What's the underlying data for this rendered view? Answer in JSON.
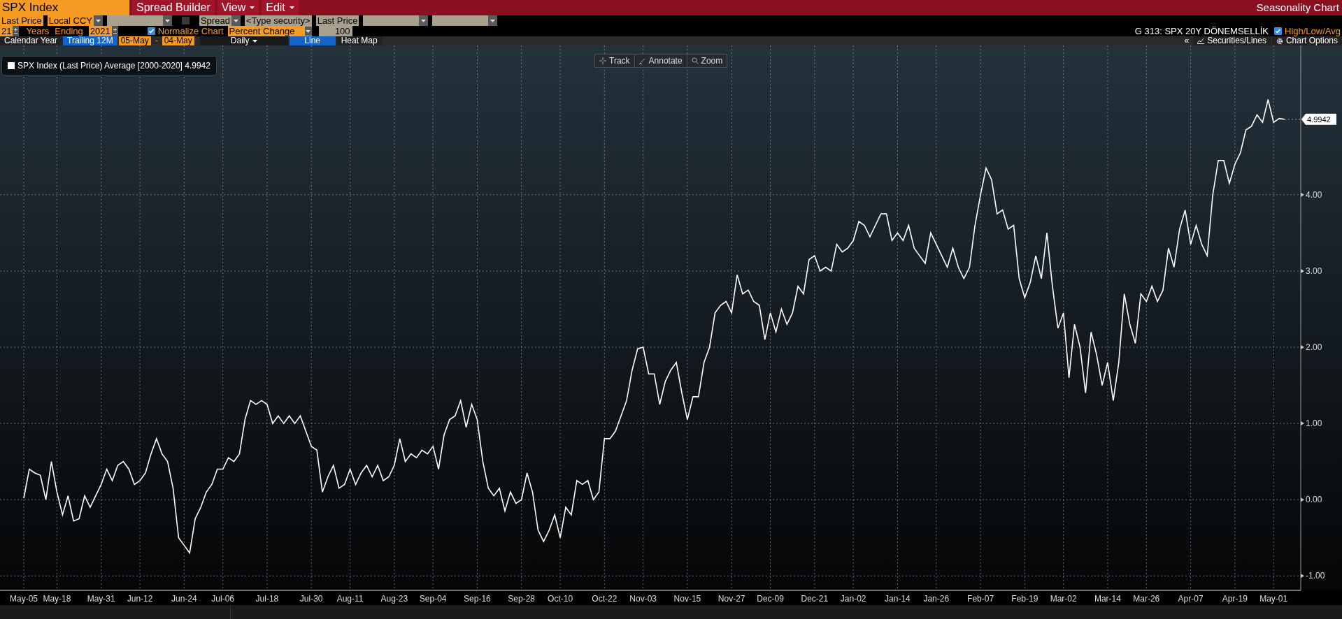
{
  "menu_bar": {
    "security": "SPX Index",
    "items": [
      {
        "label": "Spread Builder",
        "dropdown": false
      },
      {
        "label": "View",
        "dropdown": true
      },
      {
        "label": "Edit",
        "dropdown": true
      }
    ],
    "title": "Seasonality Chart"
  },
  "fields_row": [
    {
      "kind": "primary",
      "value": "Last Price",
      "dropdown": false
    },
    {
      "kind": "primary",
      "value": "Local CCY",
      "dropdown": true
    },
    {
      "kind": "secondary",
      "dropdown": true
    },
    {
      "kind": "checkbox",
      "checked": false
    },
    {
      "kind": "secondary",
      "value": "Spread",
      "dropdown": true
    },
    {
      "kind": "secondary",
      "value": "<Type security>",
      "dropdown": false
    },
    {
      "kind": "secondary",
      "value": "Last Price",
      "dropdown": false
    },
    {
      "kind": "secondary",
      "dropdown": true
    },
    {
      "kind": "secondary",
      "dropdown": true
    }
  ],
  "options_row": {
    "years": "21",
    "years_label": "Years",
    "ending_label": "Ending",
    "end_year": "2021",
    "normalize": {
      "label": "Normalize Chart",
      "checked": true
    },
    "mode": "Percent Change",
    "base": "100",
    "chart_name": "G 313: SPX 20Y DÖNEMSELLİK",
    "high_low_avg": {
      "label": "High/Low/Avg",
      "checked": true
    }
  },
  "range_row": {
    "period_tabs": [
      {
        "label": "Calendar Year",
        "selected": false
      },
      {
        "label": "Trailing 12M",
        "selected": true
      }
    ],
    "start": "05-May",
    "separator": "-",
    "end": "04-May",
    "frequency": "Daily",
    "view_tabs": [
      {
        "label": "Line",
        "selected": true
      },
      {
        "label": "Heat Map",
        "selected": false
      }
    ],
    "collapse": "«",
    "securities": "Securities/Lines",
    "chart_options": "Chart Options"
  },
  "chart": {
    "legend_value": "4.9942",
    "tools": [
      "Track",
      "Annotate",
      "Zoom"
    ],
    "chart_data": {
      "type": "line",
      "grid": true,
      "ylim": [
        -1.19,
        5.96
      ],
      "categories": [
        "May-05",
        null,
        null,
        null,
        null,
        null,
        "May-18",
        null,
        null,
        null,
        null,
        null,
        null,
        null,
        "May-31",
        null,
        null,
        null,
        null,
        null,
        null,
        "Jun-12",
        null,
        null,
        null,
        null,
        null,
        null,
        null,
        "Jun-24",
        null,
        null,
        null,
        null,
        null,
        null,
        "Jul-06",
        null,
        null,
        null,
        null,
        null,
        null,
        null,
        "Jul-18",
        null,
        null,
        null,
        null,
        null,
        null,
        null,
        "Jul-30",
        null,
        null,
        null,
        null,
        null,
        null,
        "Aug-11",
        null,
        null,
        null,
        null,
        null,
        null,
        null,
        "Aug-23",
        null,
        null,
        null,
        null,
        null,
        null,
        "Sep-04",
        null,
        null,
        null,
        null,
        null,
        null,
        null,
        "Sep-16",
        null,
        null,
        null,
        null,
        null,
        null,
        null,
        "Sep-28",
        null,
        null,
        null,
        null,
        null,
        null,
        "Oct-10",
        null,
        null,
        null,
        null,
        null,
        null,
        null,
        "Oct-22",
        null,
        null,
        null,
        null,
        null,
        null,
        "Nov-03",
        null,
        null,
        null,
        null,
        null,
        null,
        null,
        "Nov-15",
        null,
        null,
        null,
        null,
        null,
        null,
        null,
        "Nov-27",
        null,
        null,
        null,
        null,
        null,
        null,
        "Dec-09",
        null,
        null,
        null,
        null,
        null,
        null,
        null,
        "Dec-21",
        null,
        null,
        null,
        null,
        null,
        null,
        "Jan-02",
        null,
        null,
        null,
        null,
        null,
        null,
        null,
        "Jan-14",
        null,
        null,
        null,
        null,
        null,
        null,
        "Jan-26",
        null,
        null,
        null,
        null,
        null,
        null,
        null,
        "Feb-07",
        null,
        null,
        null,
        null,
        null,
        null,
        null,
        "Feb-19",
        null,
        null,
        null,
        null,
        null,
        null,
        "Mar-02",
        null,
        null,
        null,
        null,
        null,
        null,
        null,
        "Mar-14",
        null,
        null,
        null,
        null,
        null,
        null,
        "Mar-26",
        null,
        null,
        null,
        null,
        null,
        null,
        null,
        "Apr-07",
        null,
        null,
        null,
        null,
        null,
        null,
        null,
        "Apr-19",
        null,
        null,
        null,
        null,
        null,
        null,
        "May-01",
        null,
        null
      ],
      "series": [
        {
          "name": "SPX Index (Last Price) Average [2000-2020]",
          "color": "#ffffff",
          "values": [
            0.02,
            0.4,
            0.35,
            0.32,
            0.0,
            0.5,
            0.1,
            -0.2,
            0.05,
            -0.28,
            -0.25,
            0.05,
            -0.1,
            0.05,
            0.2,
            0.4,
            0.25,
            0.45,
            0.5,
            0.4,
            0.2,
            0.25,
            0.35,
            0.6,
            0.8,
            0.6,
            0.5,
            0.15,
            -0.5,
            -0.6,
            -0.7,
            -0.25,
            -0.1,
            0.1,
            0.2,
            0.4,
            0.4,
            0.55,
            0.5,
            0.6,
            1.05,
            1.3,
            1.25,
            1.3,
            1.25,
            1.0,
            1.1,
            1.0,
            1.1,
            1.0,
            1.1,
            0.9,
            0.7,
            0.65,
            0.1,
            0.3,
            0.45,
            0.15,
            0.2,
            0.4,
            0.2,
            0.35,
            0.45,
            0.3,
            0.45,
            0.25,
            0.3,
            0.45,
            0.8,
            0.5,
            0.6,
            0.55,
            0.65,
            0.6,
            0.7,
            0.4,
            0.85,
            1.05,
            1.1,
            1.3,
            0.95,
            1.25,
            1.05,
            0.5,
            0.15,
            0.05,
            0.15,
            -0.15,
            0.1,
            -0.05,
            0.0,
            0.35,
            0.1,
            -0.4,
            -0.55,
            -0.4,
            -0.2,
            -0.5,
            -0.1,
            -0.2,
            0.25,
            0.2,
            0.25,
            0.0,
            0.1,
            0.8,
            0.8,
            0.9,
            1.1,
            1.3,
            1.7,
            1.98,
            2.0,
            1.65,
            1.65,
            1.25,
            1.55,
            1.7,
            1.8,
            1.4,
            1.05,
            1.35,
            1.35,
            1.8,
            2.0,
            2.45,
            2.55,
            2.6,
            2.45,
            2.95,
            2.7,
            2.75,
            2.6,
            2.55,
            2.1,
            2.45,
            2.2,
            2.5,
            2.3,
            2.45,
            2.8,
            2.7,
            3.15,
            3.2,
            3.0,
            3.05,
            3.0,
            3.35,
            3.25,
            3.3,
            3.4,
            3.65,
            3.6,
            3.45,
            3.6,
            3.75,
            3.75,
            3.4,
            3.5,
            3.4,
            3.6,
            3.3,
            3.2,
            3.1,
            3.5,
            3.35,
            3.2,
            3.05,
            3.3,
            3.05,
            2.9,
            3.05,
            3.6,
            4.0,
            4.35,
            4.2,
            3.75,
            3.8,
            3.55,
            3.6,
            2.9,
            2.65,
            2.85,
            3.2,
            2.9,
            3.5,
            2.8,
            2.25,
            2.45,
            1.6,
            2.3,
            2.0,
            1.4,
            2.2,
            1.9,
            1.5,
            1.8,
            1.3,
            1.8,
            2.7,
            2.3,
            2.05,
            2.7,
            2.6,
            2.8,
            2.6,
            2.75,
            3.3,
            3.05,
            3.55,
            3.8,
            3.35,
            3.6,
            3.35,
            3.2,
            4.0,
            4.45,
            4.45,
            4.15,
            4.4,
            4.55,
            4.85,
            4.9,
            5.05,
            4.95,
            5.25,
            4.95,
            5.0,
            4.99
          ]
        }
      ],
      "yticks": [
        {
          "value": -1,
          "label": "-1.00"
        },
        {
          "value": 0,
          "label": "0.00"
        },
        {
          "value": 1,
          "label": "1.00"
        },
        {
          "value": 2,
          "label": "2.00"
        },
        {
          "value": 3,
          "label": "3.00"
        },
        {
          "value": 4,
          "label": "4.00"
        }
      ],
      "annotations": [
        "4.9942"
      ]
    }
  }
}
